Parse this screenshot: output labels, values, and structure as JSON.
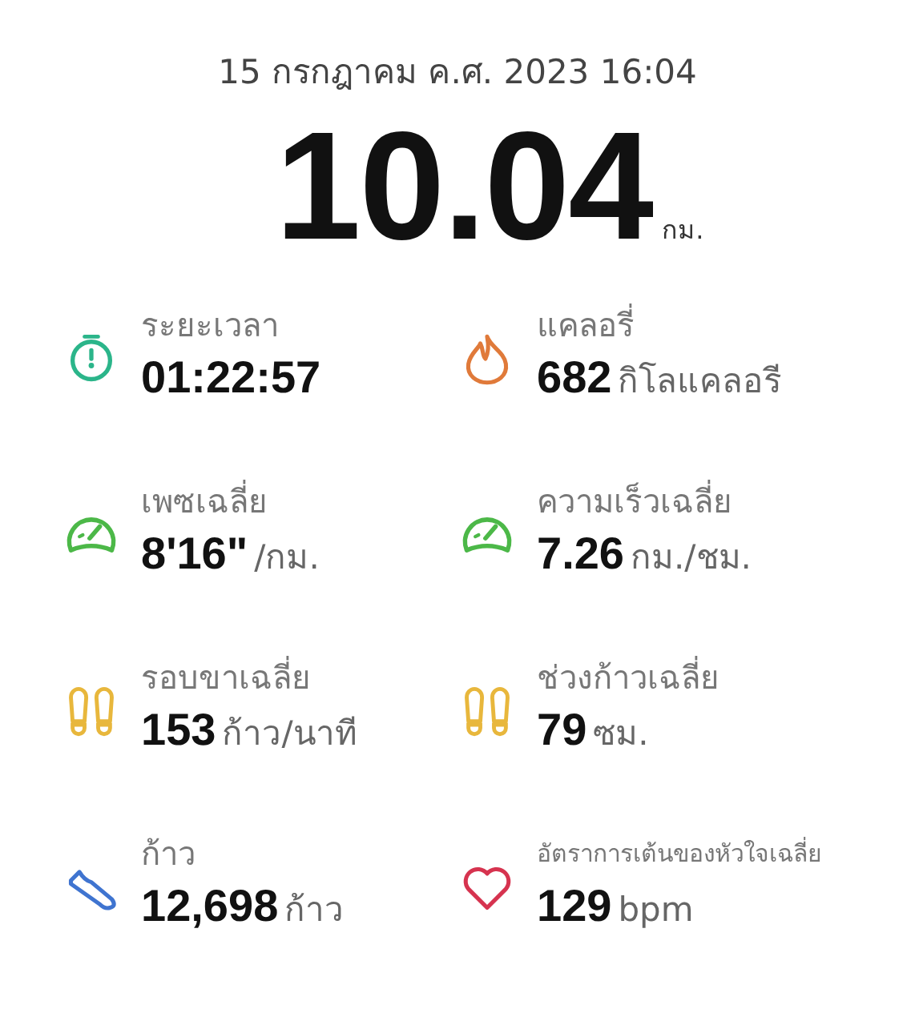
{
  "header": {
    "date": "15 กรกฎาคม ค.ศ. 2023 16:04",
    "distance": "10.04",
    "distance_unit": "กม."
  },
  "stats": [
    {
      "kind": "stopwatch",
      "color": "#2bb58a",
      "label": "ระยะเวลา",
      "value": "01:22:57"
    },
    {
      "kind": "fire",
      "color": "#e07a3a",
      "label": "แคลอรี่",
      "value": "682",
      "unit": "กิโลแคลอรี"
    },
    {
      "kind": "gauge",
      "color": "#4cb848",
      "label": "เพซเฉลี่ย",
      "value": "8'16\"",
      "unit": "/กม."
    },
    {
      "kind": "gauge",
      "color": "#4cb848",
      "label": "ความเร็วเฉลี่ย",
      "value": "7.26",
      "unit": "กม./ชม."
    },
    {
      "kind": "footprints",
      "color": "#e8b73c",
      "label": "รอบขาเฉลี่ย",
      "value": "153",
      "unit": "ก้าว/นาที"
    },
    {
      "kind": "footprints",
      "color": "#e8b73c",
      "label": "ช่วงก้าวเฉลี่ย",
      "value": "79",
      "unit": "ซม."
    },
    {
      "kind": "shoe",
      "color": "#3f74d0",
      "label": "ก้าว",
      "value": "12,698",
      "unit": "ก้าว"
    },
    {
      "kind": "heart",
      "color": "#d6334f",
      "label": "อัตราการเต้นของหัวใจเฉลี่ย",
      "value": "129",
      "unit": "bpm",
      "small_label": true
    }
  ]
}
